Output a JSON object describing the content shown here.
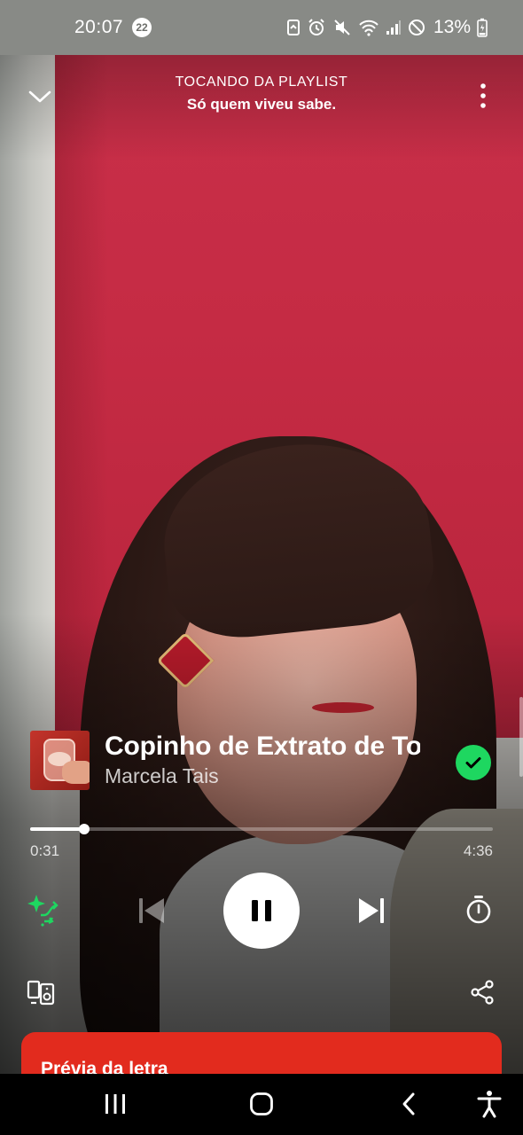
{
  "status_bar": {
    "time": "20:07",
    "notification_count": "22",
    "battery_percent": "13%"
  },
  "header": {
    "context_label": "TOCANDO DA PLAYLIST",
    "context_name": "Só quem viveu sabe."
  },
  "track": {
    "title": "Copinho de Extrato de Tomate",
    "artist": "Marcela Tais",
    "saved": true
  },
  "playback": {
    "elapsed": "0:31",
    "duration": "4:36",
    "progress_fraction": 0.117,
    "state": "playing"
  },
  "lyrics": {
    "title": "Prévia da letra"
  },
  "icons": {
    "collapse": "chevron-down-icon",
    "more": "more-vertical-icon",
    "saved": "check-circle-icon",
    "smart_shuffle": "smart-shuffle-icon",
    "previous": "skip-previous-icon",
    "pause": "pause-icon",
    "next": "skip-next-icon",
    "sleep_timer": "timer-icon",
    "devices": "connect-devices-icon",
    "share": "share-icon"
  },
  "colors": {
    "accent_green": "#1ed760",
    "lyrics_card": "#e22b1e"
  }
}
